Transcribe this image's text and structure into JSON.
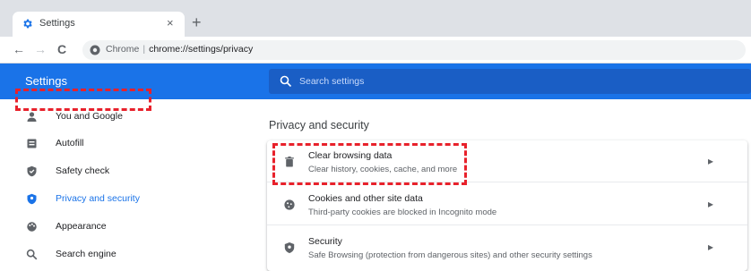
{
  "browser": {
    "tab": {
      "title": "Settings",
      "close_glyph": "×",
      "favicon": "gear-icon"
    },
    "new_tab_glyph": "+",
    "nav": {
      "back": "←",
      "forward": "→",
      "reload": "C"
    },
    "omnibox": {
      "origin": "Chrome",
      "separator": "|",
      "url": "chrome://settings/privacy"
    }
  },
  "header": {
    "title": "Settings",
    "search_placeholder": "Search settings"
  },
  "sidebar": {
    "items": [
      {
        "label": "You and Google",
        "icon": "person-icon"
      },
      {
        "label": "Autofill",
        "icon": "autofill-icon"
      },
      {
        "label": "Safety check",
        "icon": "shield-check-icon"
      },
      {
        "label": "Privacy and security",
        "icon": "shield-icon",
        "active": true
      },
      {
        "label": "Appearance",
        "icon": "palette-icon"
      },
      {
        "label": "Search engine",
        "icon": "search-icon"
      }
    ]
  },
  "main": {
    "section_title": "Privacy and security",
    "rows": [
      {
        "title": "Clear browsing data",
        "subtitle": "Clear history, cookies, cache, and more",
        "icon": "trash-icon",
        "arrow": "▸"
      },
      {
        "title": "Cookies and other site data",
        "subtitle": "Third-party cookies are blocked in Incognito mode",
        "icon": "cookie-icon",
        "arrow": "▸"
      },
      {
        "title": "Security",
        "subtitle": "Safe Browsing (protection from dangerous sites) and other security settings",
        "icon": "security-shield-icon",
        "arrow": "▸"
      }
    ]
  },
  "colors": {
    "accent": "#1a73e8",
    "highlight": "#e8212b"
  }
}
